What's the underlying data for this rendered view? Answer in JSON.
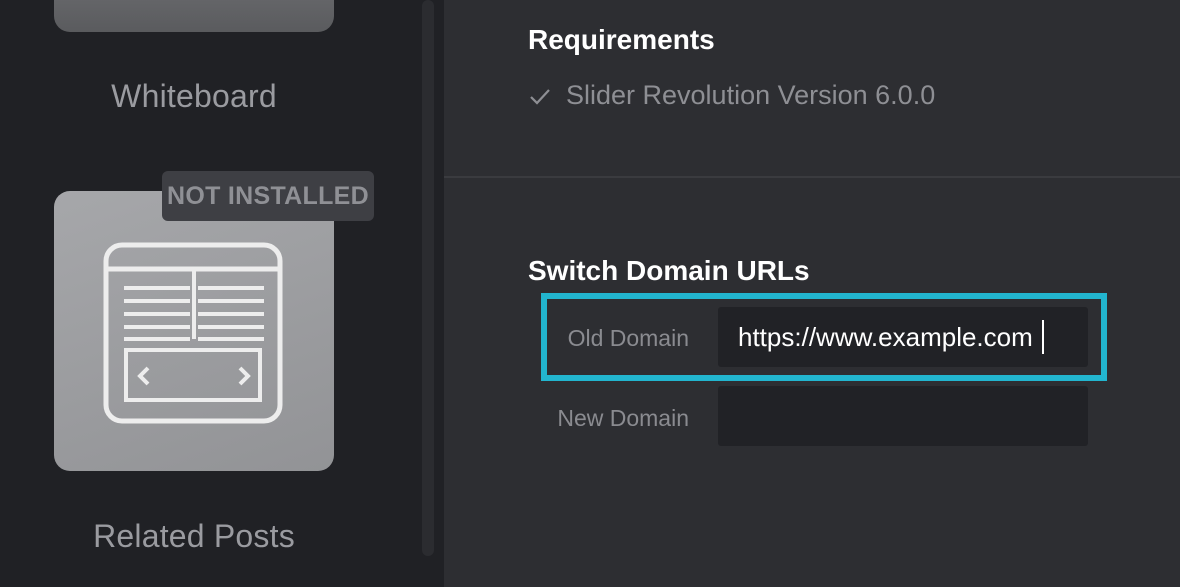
{
  "sidebar": {
    "addons": [
      {
        "title": "Whiteboard"
      },
      {
        "title": "Related Posts",
        "badge": "NOT INSTALLED",
        "icon": "related-posts-icon"
      }
    ]
  },
  "main": {
    "requirements": {
      "title": "Requirements",
      "items": [
        {
          "label": "Slider Revolution Version 6.0.0",
          "icon": "check-icon"
        }
      ]
    },
    "switch_domain": {
      "title": "Switch Domain URLs",
      "old_domain": {
        "label": "Old Domain",
        "value": "https://www.example.com"
      },
      "new_domain": {
        "label": "New Domain",
        "value": ""
      }
    }
  },
  "colors": {
    "highlight": "#22b5cf",
    "sidebar_bg": "#202125",
    "main_bg": "#2d2e32"
  }
}
